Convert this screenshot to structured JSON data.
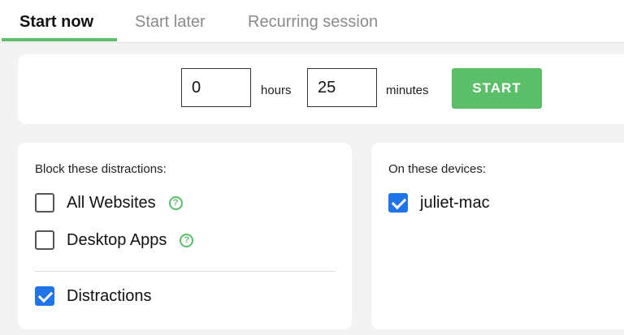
{
  "tabs": [
    {
      "label": "Start now",
      "active": true
    },
    {
      "label": "Start later",
      "active": false
    },
    {
      "label": "Recurring session",
      "active": false
    }
  ],
  "timer": {
    "hours_value": "0",
    "hours_label": "hours",
    "minutes_value": "25",
    "minutes_label": "minutes",
    "start_label": "START"
  },
  "block": {
    "heading": "Block these distractions:",
    "options": [
      {
        "label": "All Websites",
        "checked": false,
        "has_help": true
      },
      {
        "label": "Desktop Apps",
        "checked": false,
        "has_help": true
      },
      {
        "label": "Distractions",
        "checked": true,
        "has_help": false
      }
    ]
  },
  "devices": {
    "heading": "On these devices:",
    "items": [
      {
        "label": "juliet-mac",
        "checked": true
      }
    ]
  },
  "colors": {
    "accent_green": "#5bbf6a",
    "checkbox_blue": "#1f74e8"
  },
  "icons": {
    "help": "question-circle-icon",
    "check": "checkmark-icon"
  }
}
